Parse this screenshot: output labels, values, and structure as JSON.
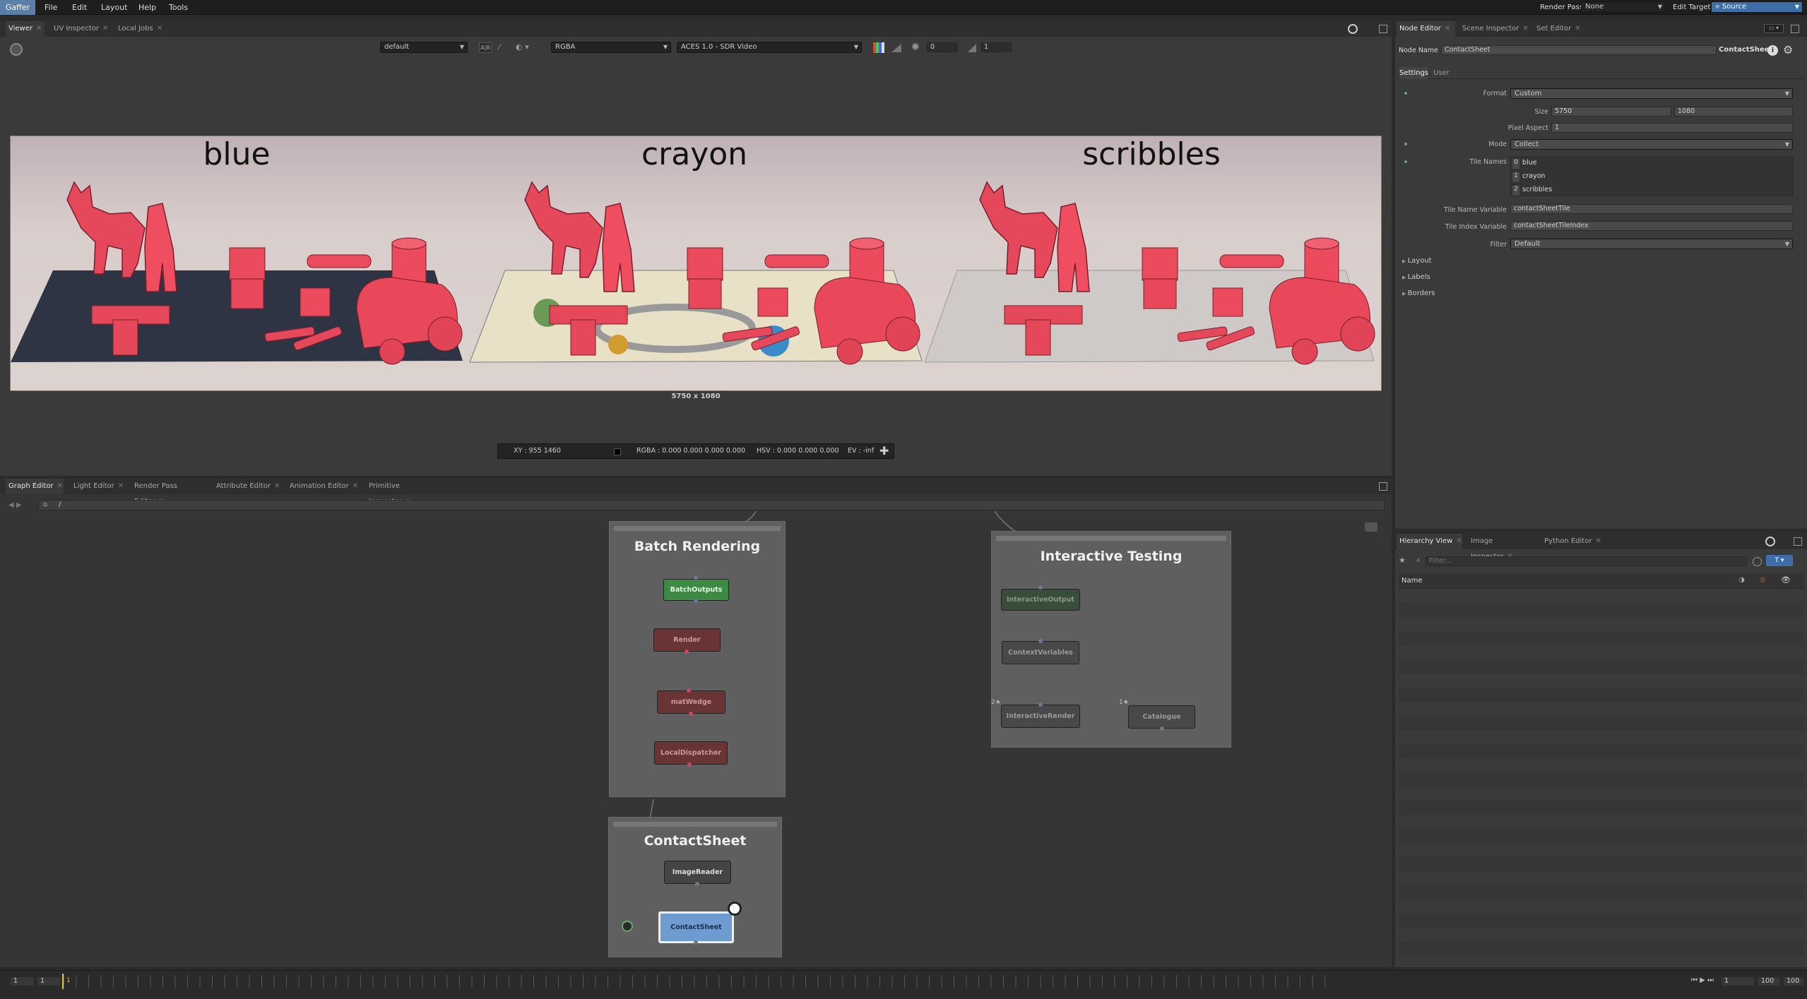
{
  "menubar": {
    "app": "Gaffer",
    "items": [
      "File",
      "Edit",
      "Layout",
      "Help",
      "Tools"
    ],
    "render_pass_label": "Render Pass",
    "render_pass_value": "None",
    "edit_target_label": "Edit Target",
    "edit_target_value": "Source"
  },
  "viewer": {
    "tabs": [
      "Viewer",
      "UV Inspector",
      "Local Jobs"
    ],
    "toolbar": {
      "display": "default",
      "channels": "RGBA",
      "colorspace": "ACES 1.0 - SDR Video",
      "exposure": "0",
      "gamma": "1"
    },
    "tiles": [
      "blue",
      "crayon",
      "scribbles"
    ],
    "resolution": "5750 x 1080",
    "status": {
      "xy": "XY : 955  1460",
      "rgba": "RGBA : 0.000 0.000 0.000 0.000",
      "hsv": "HSV : 0.000 0.000 0.000",
      "ev": "EV : -inf"
    }
  },
  "node_editor": {
    "tabs": [
      "Node Editor",
      "Scene Inspector",
      "Set Editor"
    ],
    "node_name_label": "Node Name",
    "node_name": "ContactSheet",
    "node_type": "ContactSheet",
    "subtabs": [
      "Settings",
      "User"
    ],
    "format_label": "Format",
    "format": "Custom",
    "size_label": "Size",
    "size_w": "5750",
    "size_h": "1080",
    "pixel_aspect_label": "Pixel Aspect",
    "pixel_aspect": "1",
    "mode_label": "Mode",
    "mode": "Collect",
    "tile_names_label": "Tile Names",
    "tile_names": [
      {
        "index": "0",
        "name": "blue"
      },
      {
        "index": "1",
        "name": "crayon"
      },
      {
        "index": "2",
        "name": "scribbles"
      }
    ],
    "tile_name_var_label": "Tile Name Variable",
    "tile_name_var": "contactSheetTile",
    "tile_index_var_label": "Tile Index Variable",
    "tile_index_var": "contactSheetTileIndex",
    "filter_label": "Filter",
    "filter": "Default",
    "sections": [
      "Layout",
      "Labels",
      "Borders"
    ]
  },
  "graph_editor": {
    "tabs": [
      "Graph Editor",
      "Light Editor",
      "Render Pass Editor",
      "Attribute Editor",
      "Animation Editor",
      "Primitive Inspector"
    ],
    "path": "/",
    "backdrops": {
      "batch": "Batch Rendering",
      "interactive": "Interactive Testing",
      "contact": "ContactSheet"
    },
    "nodes": {
      "batch_outputs": "BatchOutputs",
      "render": "Render",
      "mat_wedge": "matWedge",
      "local_dispatcher": "LocalDispatcher",
      "interactive_output": "InteractiveOutput",
      "context_variables": "ContextVariables",
      "interactive_render": "InteractiveRender",
      "catalogue": "Catalogue",
      "image_reader": "ImageReader",
      "contact_sheet": "ContactSheet"
    },
    "bookmarks": {
      "interactive_render": "2",
      "catalogue": "1"
    }
  },
  "hierarchy": {
    "tabs": [
      "Hierarchy View",
      "Image Inspector",
      "Python Editor"
    ],
    "filter_placeholder": "Filter...",
    "column_name": "Name"
  },
  "timeline": {
    "start": "1",
    "current": "1",
    "playhead": "1",
    "frame": "1",
    "end_a": "100",
    "end_b": "100"
  }
}
